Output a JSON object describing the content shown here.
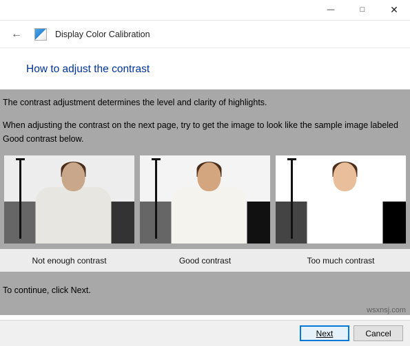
{
  "window": {
    "app_title": "Display Color Calibration"
  },
  "page": {
    "heading": "How to adjust the contrast",
    "intro": "The contrast adjustment determines the level and clarity of highlights.",
    "instruction": "When adjusting the contrast on the next page, try to get the image to look like the sample image labeled Good contrast below.",
    "continue_hint": "To continue, click Next."
  },
  "samples": [
    {
      "label": "Not enough contrast"
    },
    {
      "label": "Good contrast"
    },
    {
      "label": "Too much contrast"
    }
  ],
  "buttons": {
    "next": "Next",
    "cancel": "Cancel"
  },
  "watermark": "wsxnsj.com"
}
